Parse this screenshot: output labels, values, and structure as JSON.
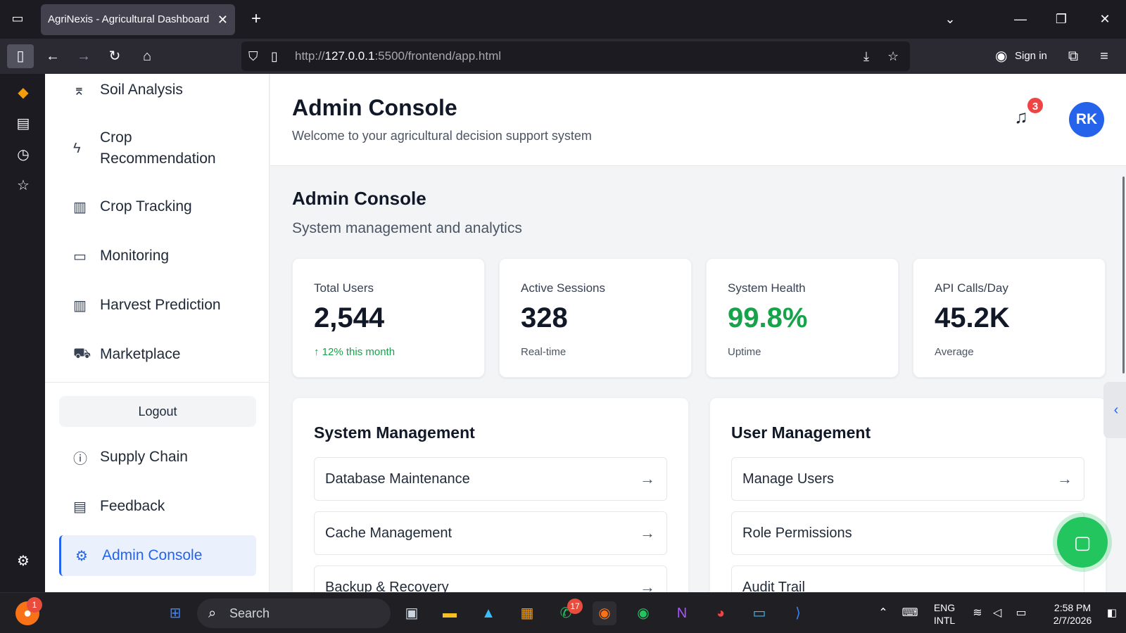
{
  "browser": {
    "tab_title": "AgriNexis - Agricultural Dashboard",
    "url_prefix": "http://",
    "url_host": "127.0.0.1",
    "url_rest": ":5500/frontend/app.html",
    "sign_in": "Sign in"
  },
  "sidebar": {
    "items": [
      {
        "label": "Soil Analysis",
        "icon": "soil-icon"
      },
      {
        "label": "Crop Recommendation",
        "icon": "lightning-icon"
      },
      {
        "label": "Crop Tracking",
        "icon": "bar-chart-icon"
      },
      {
        "label": "Monitoring",
        "icon": "video-icon"
      },
      {
        "label": "Harvest Prediction",
        "icon": "bar-chart-icon"
      },
      {
        "label": "Marketplace",
        "icon": "cart-icon"
      }
    ],
    "logout": "Logout",
    "bottom_items": [
      {
        "label": "Supply Chain",
        "icon": "info-icon"
      },
      {
        "label": "Feedback",
        "icon": "message-icon"
      },
      {
        "label": "Admin Console",
        "icon": "gear-icon",
        "active": true
      }
    ]
  },
  "header": {
    "title": "Admin Console",
    "subtitle": "Welcome to your agricultural decision support system",
    "notification_count": "3",
    "avatar_initials": "RK"
  },
  "content": {
    "title": "Admin Console",
    "subtitle": "System management and analytics",
    "stats": [
      {
        "label": "Total Users",
        "value": "2,544",
        "sub": "↑ 12% this month",
        "sub_color": "#16a34a"
      },
      {
        "label": "Active Sessions",
        "value": "328",
        "sub": "Real-time"
      },
      {
        "label": "System Health",
        "value": "99.8%",
        "value_color": "#16a34a",
        "sub": "Uptime"
      },
      {
        "label": "API Calls/Day",
        "value": "45.2K",
        "sub": "Average"
      }
    ],
    "system_management": {
      "title": "System Management",
      "actions": [
        "Database Maintenance",
        "Cache Management",
        "Backup & Recovery"
      ]
    },
    "user_management": {
      "title": "User Management",
      "actions": [
        "Manage Users",
        "Role Permissions",
        "Audit Trail"
      ]
    },
    "arrow": "→"
  },
  "taskbar": {
    "search_placeholder": "Search",
    "notification_badge": "1",
    "whatsapp_badge": "17",
    "lang": "ENG",
    "layout": "INTL",
    "time": "2:58 PM",
    "date": "2/7/2026"
  },
  "colors": {
    "accent": "#2563eb",
    "success": "#16a34a",
    "badge": "#ef4444"
  }
}
